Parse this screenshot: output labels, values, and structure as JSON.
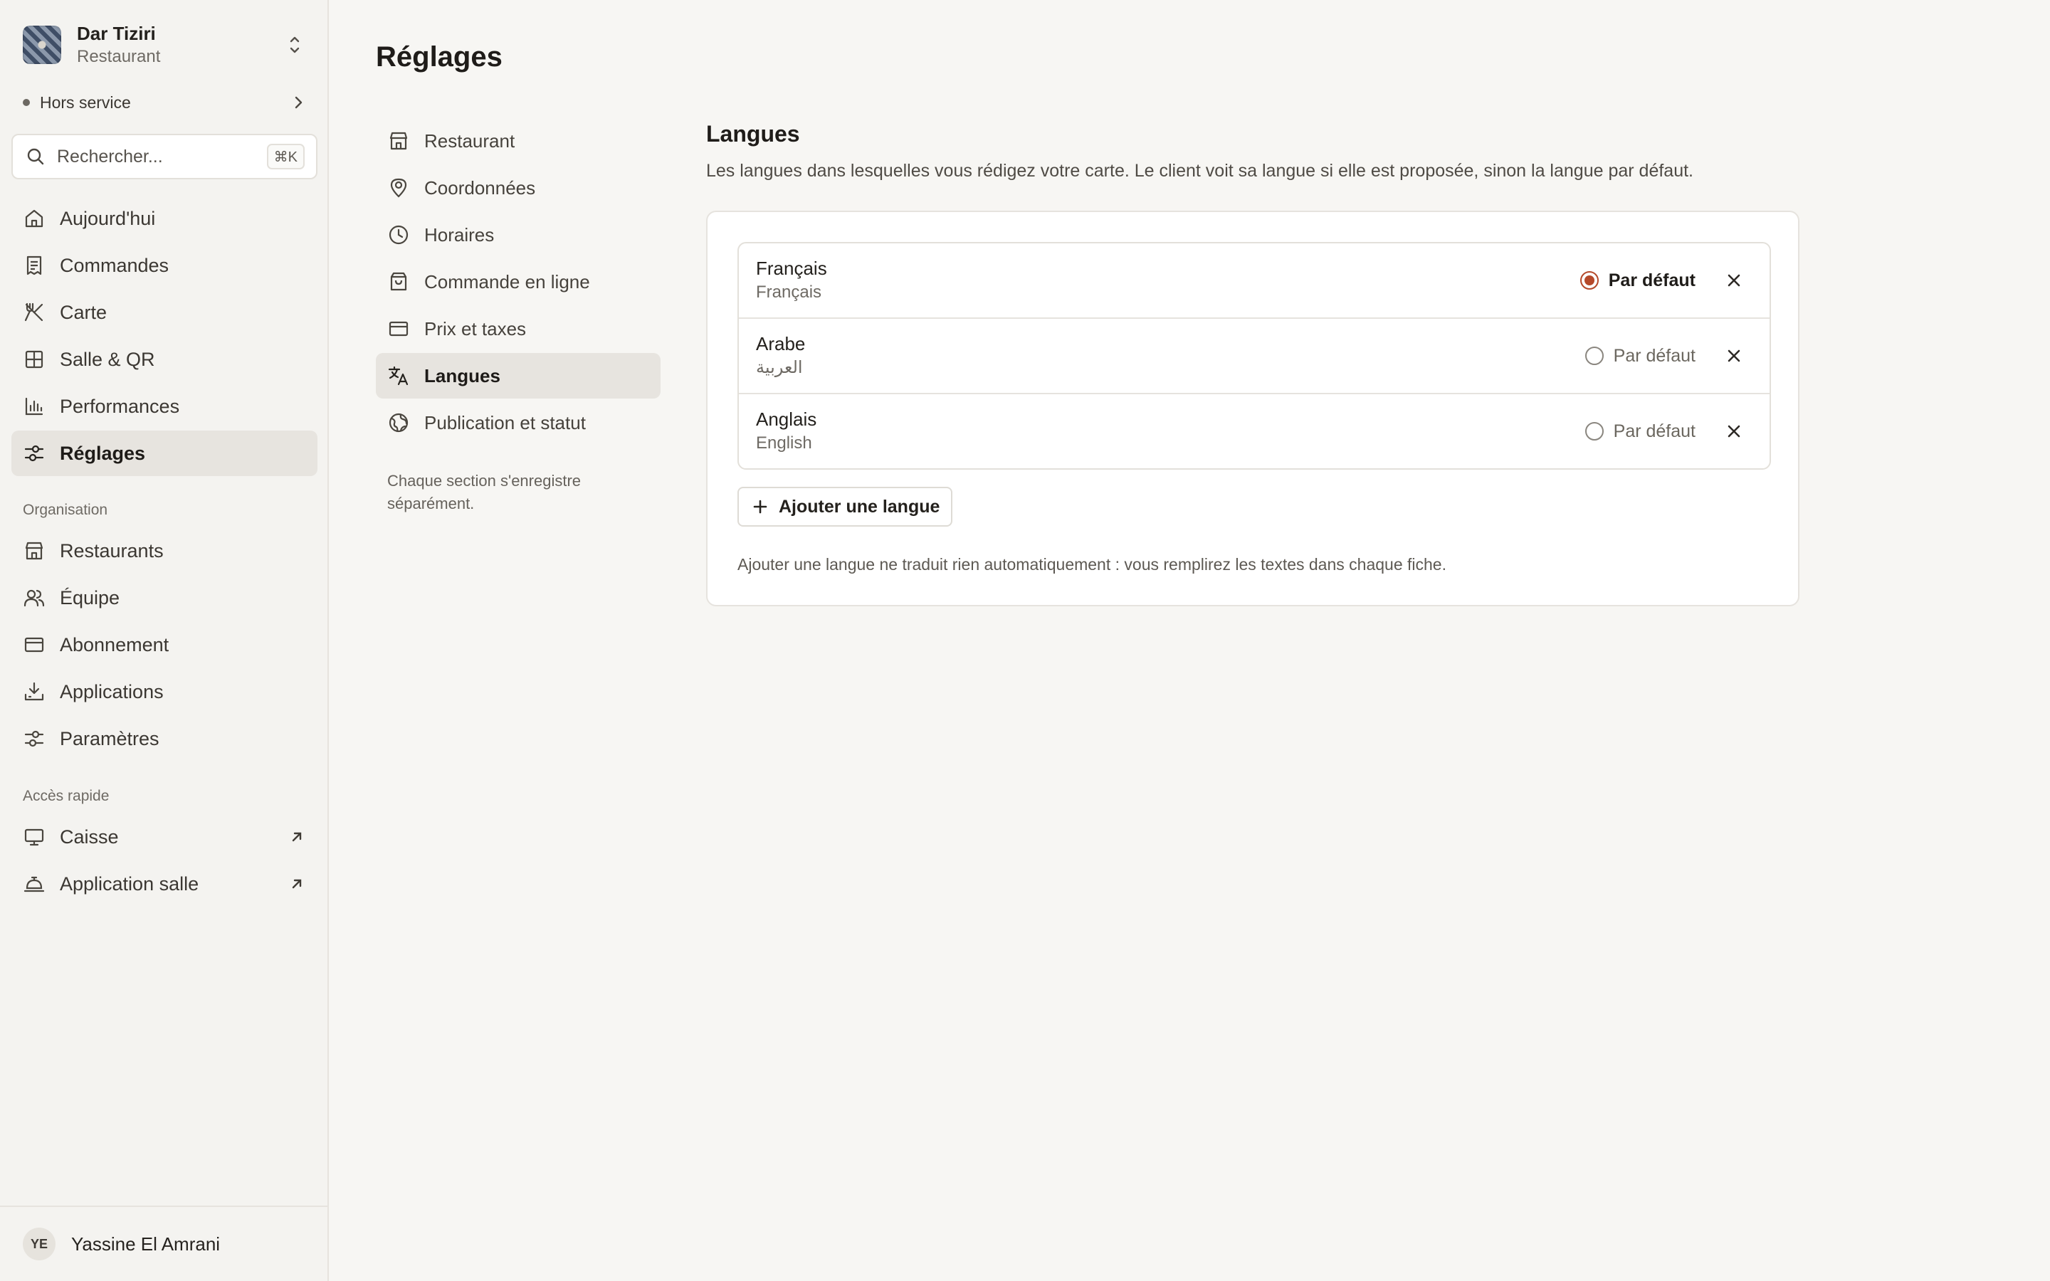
{
  "brand": {
    "name": "Dar Tiziri",
    "type": "Restaurant"
  },
  "status": {
    "label": "Hors service"
  },
  "search": {
    "placeholder": "Rechercher...",
    "shortcut": "⌘K"
  },
  "nav": {
    "main": [
      {
        "label": "Aujourd'hui",
        "icon": "home-icon"
      },
      {
        "label": "Commandes",
        "icon": "receipt-icon"
      },
      {
        "label": "Carte",
        "icon": "utensils-icon"
      },
      {
        "label": "Salle & QR",
        "icon": "grid-icon"
      },
      {
        "label": "Performances",
        "icon": "bar-chart-icon"
      },
      {
        "label": "Réglages",
        "icon": "sliders-icon",
        "active": true
      }
    ],
    "organisation_label": "Organisation",
    "organisation": [
      {
        "label": "Restaurants",
        "icon": "store-icon"
      },
      {
        "label": "Équipe",
        "icon": "users-icon"
      },
      {
        "label": "Abonnement",
        "icon": "credit-card-icon"
      },
      {
        "label": "Applications",
        "icon": "download-icon"
      },
      {
        "label": "Paramètres",
        "icon": "sliders-icon"
      }
    ],
    "quick_label": "Accès rapide",
    "quick": [
      {
        "label": "Caisse",
        "icon": "monitor-icon"
      },
      {
        "label": "Application salle",
        "icon": "cloche-icon"
      }
    ]
  },
  "user": {
    "initials": "YE",
    "name": "Yassine El Amrani"
  },
  "page": {
    "title": "Réglages"
  },
  "settings_nav": {
    "items": [
      {
        "label": "Restaurant",
        "icon": "store-icon"
      },
      {
        "label": "Coordonnées",
        "icon": "map-pin-icon"
      },
      {
        "label": "Horaires",
        "icon": "clock-icon"
      },
      {
        "label": "Commande en ligne",
        "icon": "shopping-bag-icon"
      },
      {
        "label": "Prix et taxes",
        "icon": "credit-card-icon"
      },
      {
        "label": "Langues",
        "icon": "translate-icon",
        "active": true
      },
      {
        "label": "Publication et statut",
        "icon": "globe-icon"
      }
    ],
    "note": "Chaque section s'enregistre séparément."
  },
  "languages": {
    "title": "Langues",
    "description": "Les langues dans lesquelles vous rédigez votre carte. Le client voit sa langue si elle est proposée, sinon la langue par défaut.",
    "default_label": "Par défaut",
    "items": [
      {
        "name": "Français",
        "native": "Français",
        "default": true
      },
      {
        "name": "Arabe",
        "native": "العربية",
        "default": false
      },
      {
        "name": "Anglais",
        "native": "English",
        "default": false
      }
    ],
    "add_label": "Ajouter une langue",
    "note": "Ajouter une langue ne traduit rien automatiquement : vous remplirez les textes dans chaque fiche.",
    "accent_color": "#b5492a"
  }
}
